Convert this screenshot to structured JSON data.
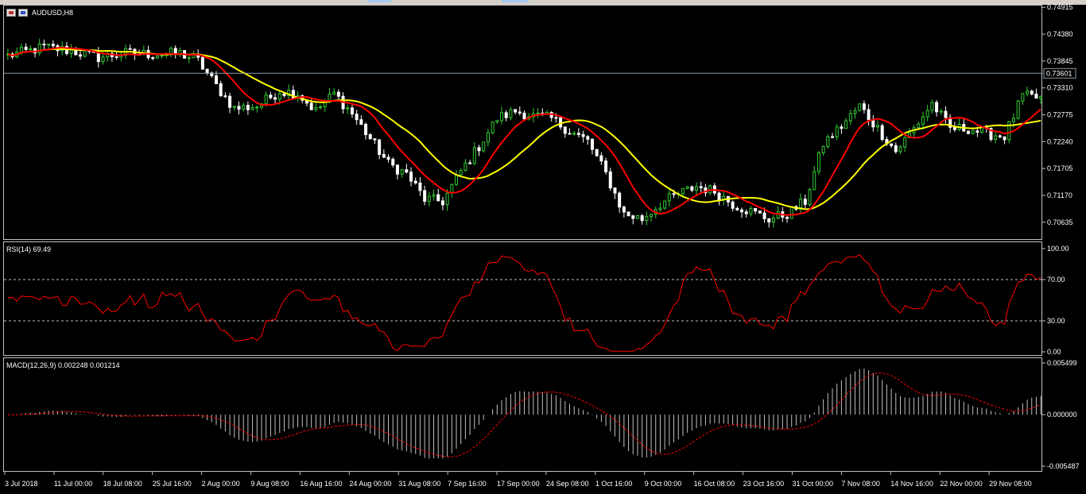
{
  "window": {
    "title": "AUDUSD,H8"
  },
  "chart_data": [
    {
      "type": "candlestick",
      "name": "main",
      "title": "AUDUSD,H8",
      "ylim": [
        0.703,
        0.7495
      ],
      "y_ticks": [
        "0.74915",
        "0.74380",
        "0.73845",
        "0.73310",
        "0.72775",
        "0.72240",
        "0.71705",
        "0.71170",
        "0.70635"
      ],
      "current_price": "0.73601",
      "candle_up_color": "#32cd32",
      "candle_down_color": "#ffffff",
      "close_path_anchors": [
        [
          0,
          0.7395
        ],
        [
          8,
          0.7412
        ],
        [
          14,
          0.7405
        ],
        [
          20,
          0.7392
        ],
        [
          26,
          0.74
        ],
        [
          32,
          0.7398
        ],
        [
          38,
          0.74
        ],
        [
          42,
          0.7385
        ],
        [
          46,
          0.7335
        ],
        [
          50,
          0.729
        ],
        [
          55,
          0.7295
        ],
        [
          60,
          0.7325
        ],
        [
          64,
          0.732
        ],
        [
          68,
          0.7285
        ],
        [
          72,
          0.732
        ],
        [
          76,
          0.728
        ],
        [
          80,
          0.723
        ],
        [
          84,
          0.718
        ],
        [
          88,
          0.716
        ],
        [
          92,
          0.711
        ],
        [
          96,
          0.7105
        ],
        [
          100,
          0.7165
        ],
        [
          104,
          0.7215
        ],
        [
          108,
          0.727
        ],
        [
          112,
          0.7285
        ],
        [
          116,
          0.7275
        ],
        [
          120,
          0.727
        ],
        [
          124,
          0.7245
        ],
        [
          128,
          0.7225
        ],
        [
          132,
          0.716
        ],
        [
          136,
          0.708
        ],
        [
          140,
          0.707
        ],
        [
          144,
          0.71
        ],
        [
          148,
          0.712
        ],
        [
          152,
          0.7135
        ],
        [
          156,
          0.7125
        ],
        [
          160,
          0.71
        ],
        [
          164,
          0.7085
        ],
        [
          168,
          0.707
        ],
        [
          172,
          0.708
        ],
        [
          176,
          0.7105
        ],
        [
          180,
          0.722
        ],
        [
          184,
          0.7255
        ],
        [
          188,
          0.7295
        ],
        [
          192,
          0.725
        ],
        [
          196,
          0.7205
        ],
        [
          200,
          0.725
        ],
        [
          204,
          0.73
        ],
        [
          208,
          0.725
        ],
        [
          212,
          0.725
        ],
        [
          216,
          0.724
        ],
        [
          220,
          0.7235
        ],
        [
          224,
          0.7315
        ],
        [
          228,
          0.731
        ]
      ],
      "bars_count": 229,
      "ma_fast_color": "#ff0000",
      "ma_slow_color": "#ffff00",
      "ma_fast_period": 10,
      "ma_slow_period": 21
    },
    {
      "type": "line",
      "name": "rsi",
      "title": "RSI(14) 69.49",
      "ylim": [
        0,
        100
      ],
      "y_ticks": [
        "100.00",
        "70.00",
        "30.00",
        "0.00"
      ],
      "levels": [
        70,
        30
      ],
      "line_color": "#ff0000"
    },
    {
      "type": "histogram",
      "name": "macd",
      "title": "MACD(12,26,9) 0.002248 0.001214",
      "ylim": [
        -0.005487,
        0.005499
      ],
      "y_ticks": [
        "0.005499",
        "0.000000",
        "-0.005487"
      ],
      "hist_color": "#c0c0c0",
      "signal_color": "#ff0000"
    }
  ],
  "x_axis": {
    "labels": [
      "3 Jul 2018",
      "11 Jul 00:00",
      "18 Jul 08:00",
      "25 Jul 16:00",
      "2 Aug 00:00",
      "9 Aug 08:00",
      "16 Aug 16:00",
      "24 Aug 00:00",
      "31 Aug 08:00",
      "7 Sep 16:00",
      "17 Sep 00:00",
      "24 Sep 08:00",
      "1 Oct 16:00",
      "9 Oct 00:00",
      "16 Oct 08:00",
      "23 Oct 16:00",
      "31 Oct 00:00",
      "7 Nov 08:00",
      "14 Nov 16:00",
      "22 Nov 00:00",
      "29 Nov 08:00"
    ]
  }
}
